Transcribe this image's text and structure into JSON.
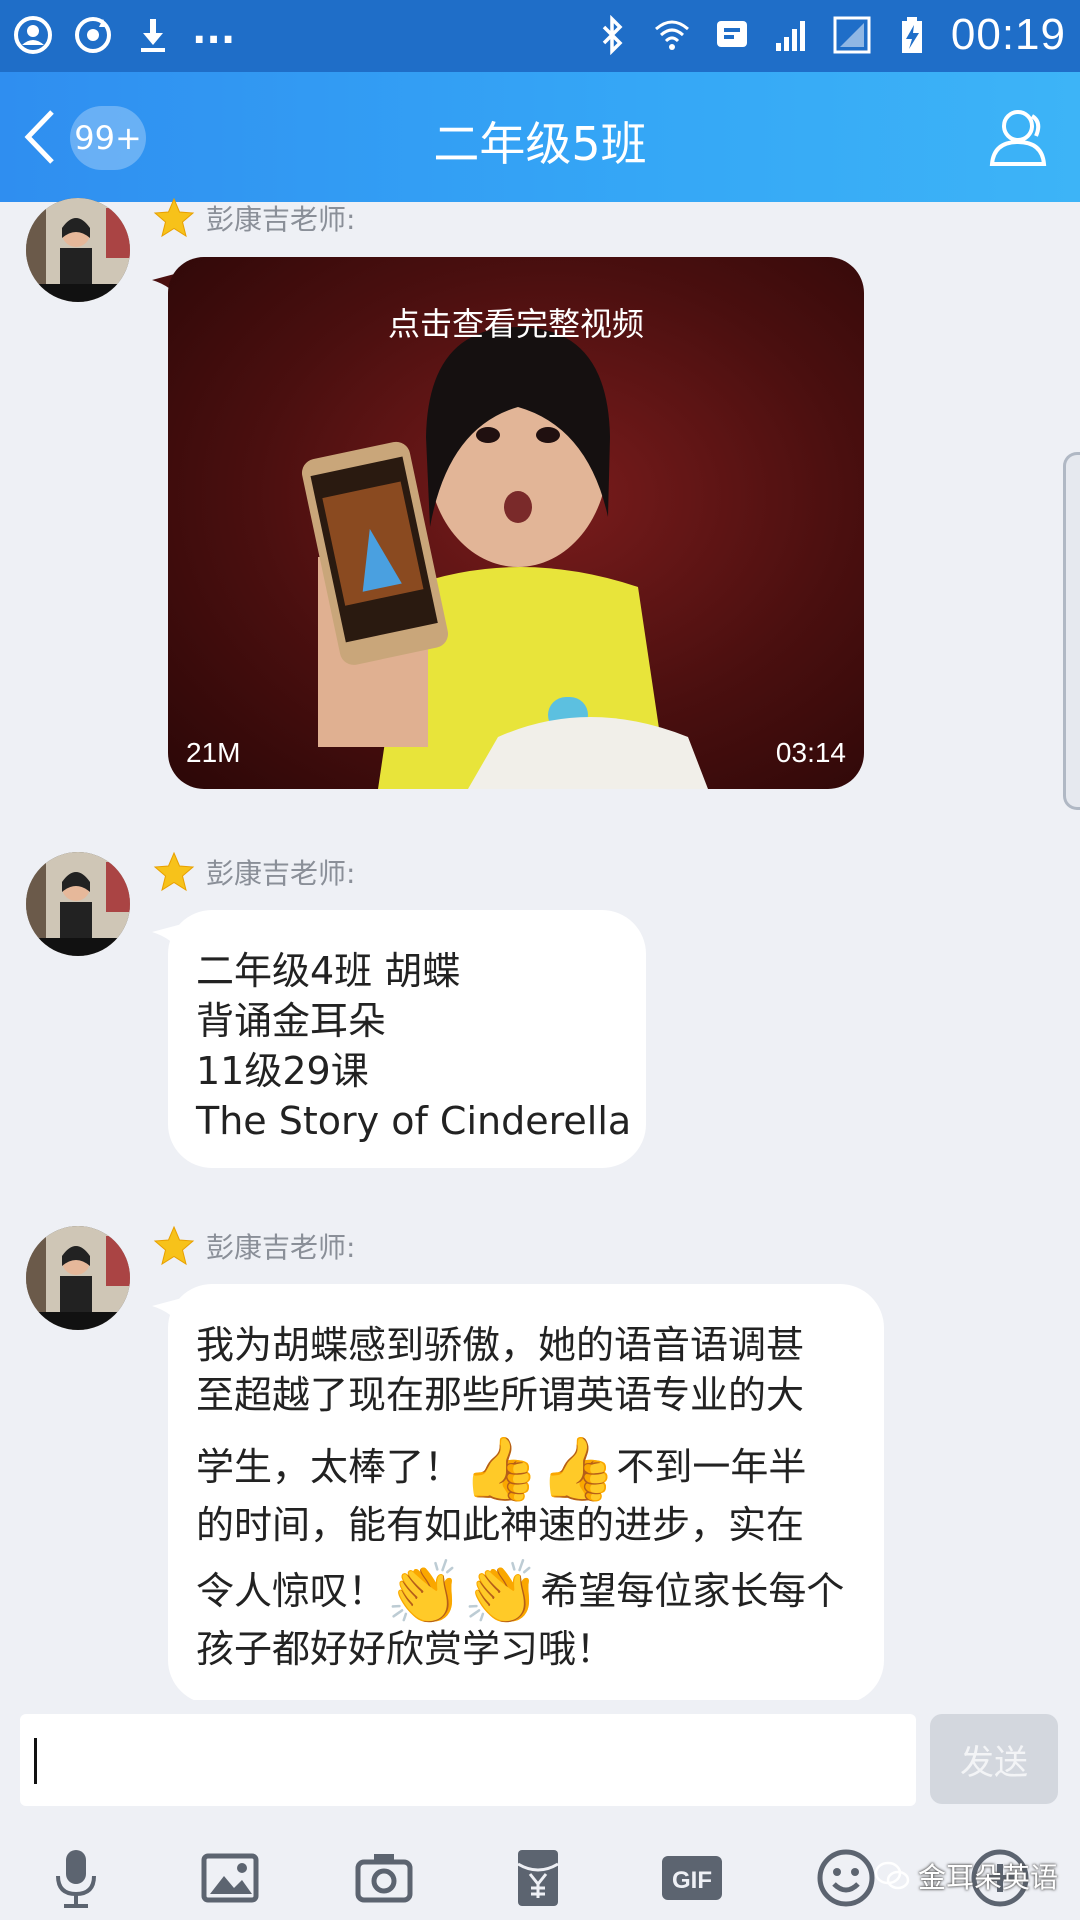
{
  "status_bar": {
    "time": "00:19",
    "left_icons": [
      "account-icon",
      "sync-icon",
      "download-icon"
    ],
    "more": "...",
    "right_icons": [
      "bluetooth-icon",
      "wifi-icon",
      "message-icon",
      "signal-icon",
      "signal-weak-icon",
      "battery-charging-icon"
    ]
  },
  "header": {
    "back_badge": "99+",
    "title": "二年级5班",
    "right_icon": "contact-icon"
  },
  "messages": [
    {
      "sender": "彭康吉老师:",
      "type": "video",
      "caption": "点击查看完整视频",
      "size": "21M",
      "duration": "03:14"
    },
    {
      "sender": "彭康吉老师:",
      "type": "text",
      "lines": [
        "二年级4班  胡蝶",
        "背诵金耳朵",
        "11级29课",
        "The Story of Cinderella"
      ]
    },
    {
      "sender": "彭康吉老师:",
      "type": "text",
      "segments": {
        "l1": "我为胡蝶感到骄傲，她的语音语调甚",
        "l2": "至超越了现在那些所谓英语专业的大",
        "l3a": "学生，太棒了！",
        "emoji_a": "👍👍",
        "l3b": "不到一年半",
        "l4": "的时间，能有如此神速的进步，实在",
        "l5a": "令人惊叹！",
        "emoji_b": "👏👏",
        "l5b": "希望每位家长每个",
        "l6": "孩子都好好欣赏学习哦！"
      }
    }
  ],
  "composer": {
    "send_label": "发送",
    "tools": [
      "microphone-icon",
      "image-icon",
      "camera-icon",
      "red-packet-icon",
      "gif-icon",
      "emoji-icon",
      "plus-icon"
    ]
  },
  "watermark": "金耳朵英语"
}
